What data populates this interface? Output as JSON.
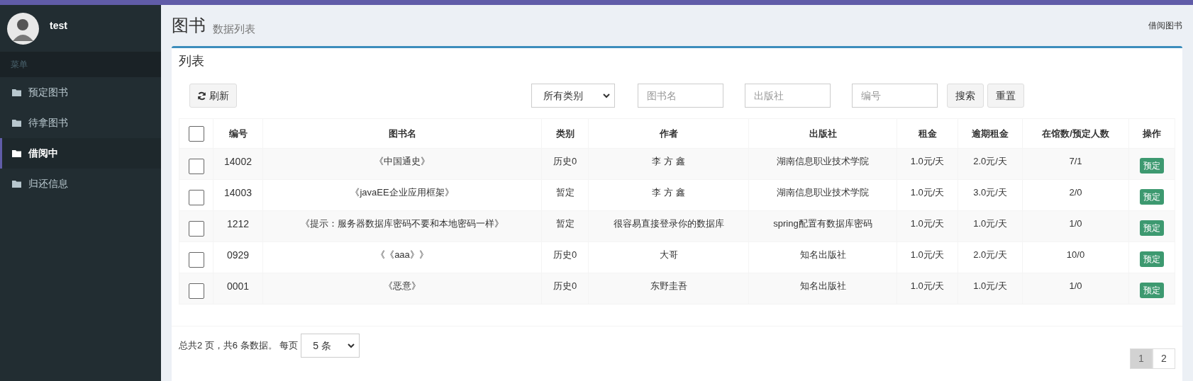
{
  "sidebar": {
    "user": {
      "name": "test"
    },
    "menu_header": "菜单",
    "items": [
      {
        "label": "预定图书",
        "selected": false
      },
      {
        "label": "待拿图书",
        "selected": false
      },
      {
        "label": "借阅中",
        "selected": true
      },
      {
        "label": "归还信息",
        "selected": false
      }
    ]
  },
  "header": {
    "title": "图书",
    "subtitle": "数据列表",
    "breadcrumb": "借阅图书"
  },
  "card": {
    "title": "列表",
    "toolbar": {
      "refresh": "刷新",
      "category": "所有类别",
      "fields": [
        {
          "placeholder": "图书名"
        },
        {
          "placeholder": "出版社"
        },
        {
          "placeholder": "编号"
        }
      ],
      "buttons": [
        "搜索",
        "重置"
      ]
    },
    "table": {
      "select_all": {
        "checked": false
      },
      "columns": [
        "编号",
        "图书名",
        "类别",
        "作者",
        "出版社",
        "租金",
        "逾期租金",
        "在馆数/预定人数",
        "操作"
      ],
      "rows": [
        {
          "checked": false,
          "cells": [
            "14002",
            "《中国通史》",
            "历史0",
            "李 方 鑫",
            "湖南信息职业技术学院",
            "1.0元/天",
            "2.0元/天",
            "7/1"
          ],
          "action": "预定"
        },
        {
          "checked": false,
          "cells": [
            "14003",
            "《javaEE企业应用框架》",
            "暂定",
            "李 方 鑫",
            "湖南信息职业技术学院",
            "1.0元/天",
            "3.0元/天",
            "2/0"
          ],
          "action": "预定"
        },
        {
          "checked": false,
          "cells": [
            "1212",
            "《提示：服务器数据库密码不要和本地密码一样》",
            "暂定",
            "很容易直接登录你的数据库",
            "spring配置有数据库密码",
            "1.0元/天",
            "1.0元/天",
            "1/0"
          ],
          "action": "预定"
        },
        {
          "checked": false,
          "cells": [
            "0929",
            "《《aaa》》",
            "历史0",
            "大哥",
            "知名出版社",
            "1.0元/天",
            "2.0元/天",
            "10/0"
          ],
          "action": "预定"
        },
        {
          "checked": false,
          "cells": [
            "0001",
            "《恶意》",
            "历史0",
            "东野圭吾",
            "知名出版社",
            "1.0元/天",
            "1.0元/天",
            "1/0"
          ],
          "action": "预定"
        }
      ]
    },
    "footer": {
      "summary": "总共2 页，共6 条数据。 每页",
      "per_page": "5 条",
      "pages": [
        {
          "label": "1",
          "selected": true
        },
        {
          "label": "2",
          "selected": false
        }
      ]
    }
  }
}
